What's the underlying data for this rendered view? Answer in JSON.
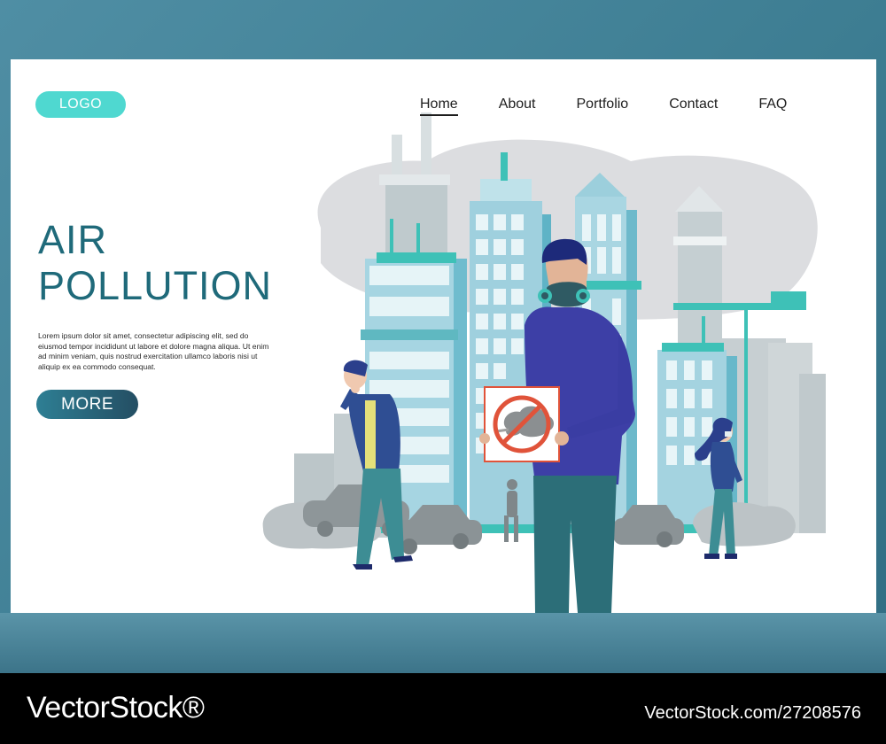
{
  "header": {
    "logo": "LOGO",
    "nav": [
      "Home",
      "About",
      "Portfolio",
      "Contact",
      "FAQ"
    ],
    "active_nav": "Home"
  },
  "hero": {
    "title_line1": "AIR",
    "title_line2": "POLLUTION",
    "body": "Lorem ipsum dolor sit amet, consectetur adipiscing elit, sed do eiusmod tempor incididunt ut labore et dolore magna aliqua. Ut enim ad minim veniam, quis nostrud exercitation ullamco laboris nisi ut aliquip ex ea commodo consequat.",
    "cta": "MORE"
  },
  "watermark": {
    "brand": "VectorStock®",
    "id": "VectorStock.com/27208576"
  },
  "colors": {
    "accent": "#4fd8d0",
    "title": "#1f6a7a",
    "frame": "#3d7d92",
    "button_dark": "#244e63"
  },
  "icons": [
    "no-smoke-sign-icon",
    "gas-mask-icon"
  ]
}
